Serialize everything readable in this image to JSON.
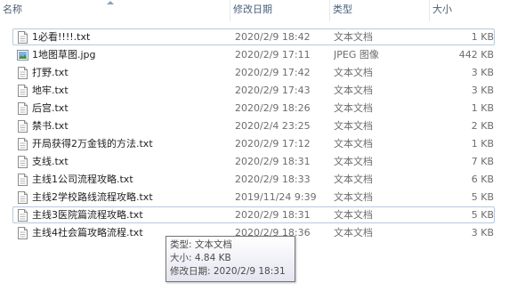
{
  "columns": {
    "name": "名称",
    "date": "修改日期",
    "type": "类型",
    "size": "大小"
  },
  "files": [
    {
      "name": "1必看!!!!.txt",
      "date": "2020/2/9 18:42",
      "type": "文本文档",
      "size": "1 KB",
      "icon": "text-file-icon"
    },
    {
      "name": "1地图草图.jpg",
      "date": "2020/2/9 17:11",
      "type": "JPEG 图像",
      "size": "442 KB",
      "icon": "image-file-icon"
    },
    {
      "name": "打野.txt",
      "date": "2020/2/9 17:42",
      "type": "文本文档",
      "size": "3 KB",
      "icon": "text-file-icon"
    },
    {
      "name": "地牢.txt",
      "date": "2020/2/9 17:43",
      "type": "文本文档",
      "size": "3 KB",
      "icon": "text-file-icon"
    },
    {
      "name": "后宫.txt",
      "date": "2020/2/9 18:26",
      "type": "文本文档",
      "size": "1 KB",
      "icon": "text-file-icon"
    },
    {
      "name": "禁书.txt",
      "date": "2020/2/4 23:25",
      "type": "文本文档",
      "size": "2 KB",
      "icon": "text-file-icon"
    },
    {
      "name": "开局获得2万金钱的方法.txt",
      "date": "2020/2/9 17:12",
      "type": "文本文档",
      "size": "1 KB",
      "icon": "text-file-icon"
    },
    {
      "name": "支线.txt",
      "date": "2020/2/9 18:31",
      "type": "文本文档",
      "size": "7 KB",
      "icon": "text-file-icon"
    },
    {
      "name": "主线1公司流程攻略.txt",
      "date": "2020/2/9 18:33",
      "type": "文本文档",
      "size": "6 KB",
      "icon": "text-file-icon"
    },
    {
      "name": "主线2学校路线流程攻略.txt",
      "date": "2019/11/24 9:39",
      "type": "文本文档",
      "size": "5 KB",
      "icon": "text-file-icon"
    },
    {
      "name": "主线3医院篇流程攻略.txt",
      "date": "2020/2/9 18:31",
      "type": "文本文档",
      "size": "5 KB",
      "icon": "text-file-icon"
    },
    {
      "name": "主线4社会篇攻略流程.txt",
      "date": "2020/2/9 18:36",
      "type": "文本文档",
      "size": "3 KB",
      "icon": "text-file-icon"
    }
  ],
  "selected_indices": [
    0,
    10
  ],
  "tooltip": {
    "type_line": "类型: 文本文档",
    "size_line": "大小: 4.84 KB",
    "date_line": "修改日期: 2020/2/9 18:31"
  },
  "colors": {
    "header_text": "#4c607a",
    "selection_border": "#b8c9dc",
    "secondary_text": "#6d6d6d"
  }
}
